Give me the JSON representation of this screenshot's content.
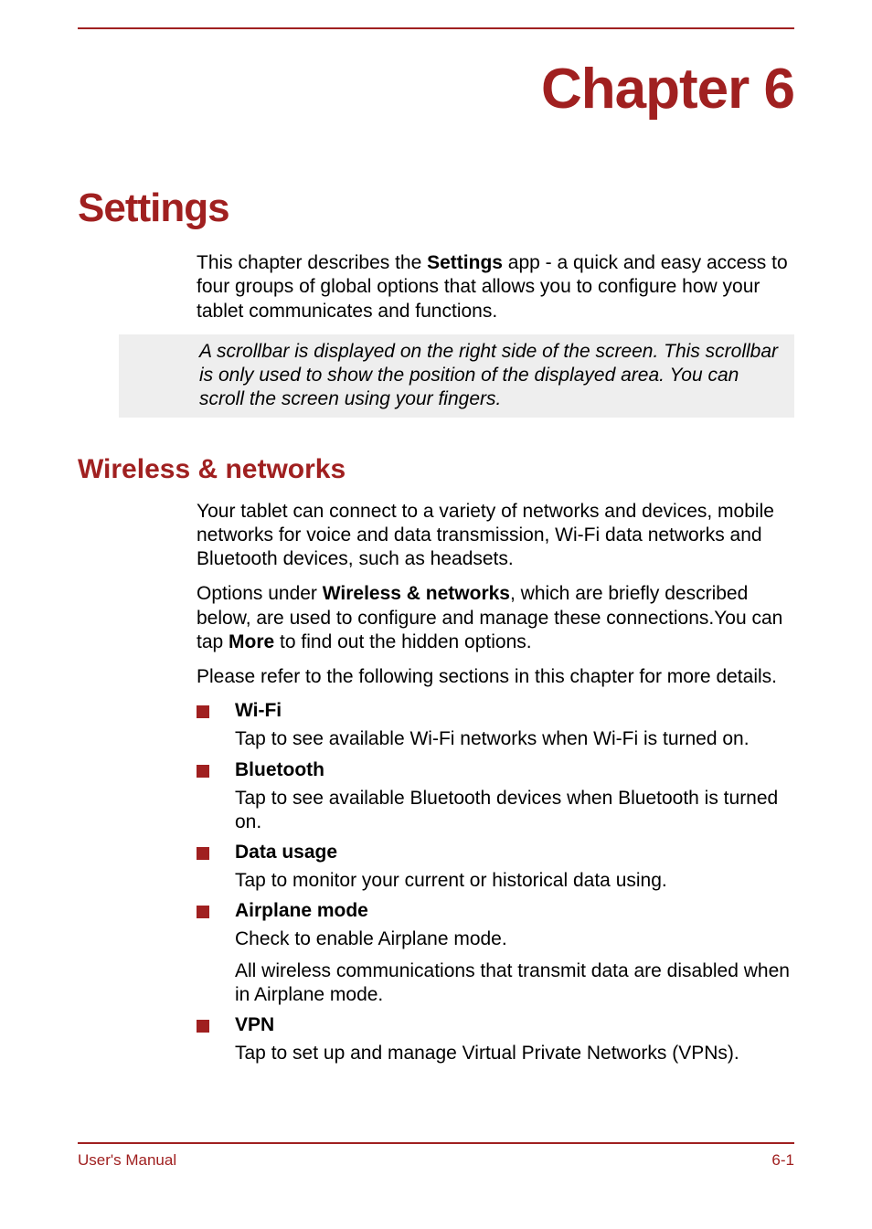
{
  "chapter_title": "Chapter 6",
  "section_title": "Settings",
  "intro_prefix": "This chapter describes the ",
  "intro_bold": "Settings",
  "intro_suffix": " app - a quick and easy access to four groups of global options that allows you to configure how your tablet communicates and functions.",
  "note": "A scrollbar is displayed on the right side of the screen. This scrollbar is only used to show the position of the displayed area. You can scroll the screen using your fingers.",
  "subsection_title": "Wireless & networks",
  "wn_para1": "Your tablet can connect to a variety of networks and devices, mobile networks for voice and data transmission, Wi-Fi data networks and Bluetooth devices, such as headsets.",
  "wn_para2_prefix": "Options under ",
  "wn_para2_bold1": "Wireless & networks",
  "wn_para2_mid": ", which are briefly described below, are used to configure and manage these connections.You can tap ",
  "wn_para2_bold2": "More",
  "wn_para2_suffix": " to find out the hidden options.",
  "wn_para3": "Please refer to the following sections in this chapter for more details.",
  "items": [
    {
      "label": "Wi-Fi",
      "desc": [
        "Tap to see available Wi-Fi networks when Wi-Fi is turned on."
      ]
    },
    {
      "label": "Bluetooth",
      "desc": [
        "Tap to see available Bluetooth devices when Bluetooth is turned on."
      ]
    },
    {
      "label": "Data usage",
      "desc": [
        "Tap to monitor your current or historical data using."
      ]
    },
    {
      "label": "Airplane mode",
      "desc": [
        "Check to enable Airplane mode.",
        "All wireless communications that transmit data are disabled when in Airplane mode."
      ]
    },
    {
      "label": "VPN",
      "desc": [
        "Tap to set up and manage Virtual Private Networks (VPNs)."
      ]
    }
  ],
  "footer_left": "User's Manual",
  "footer_right": "6-1"
}
